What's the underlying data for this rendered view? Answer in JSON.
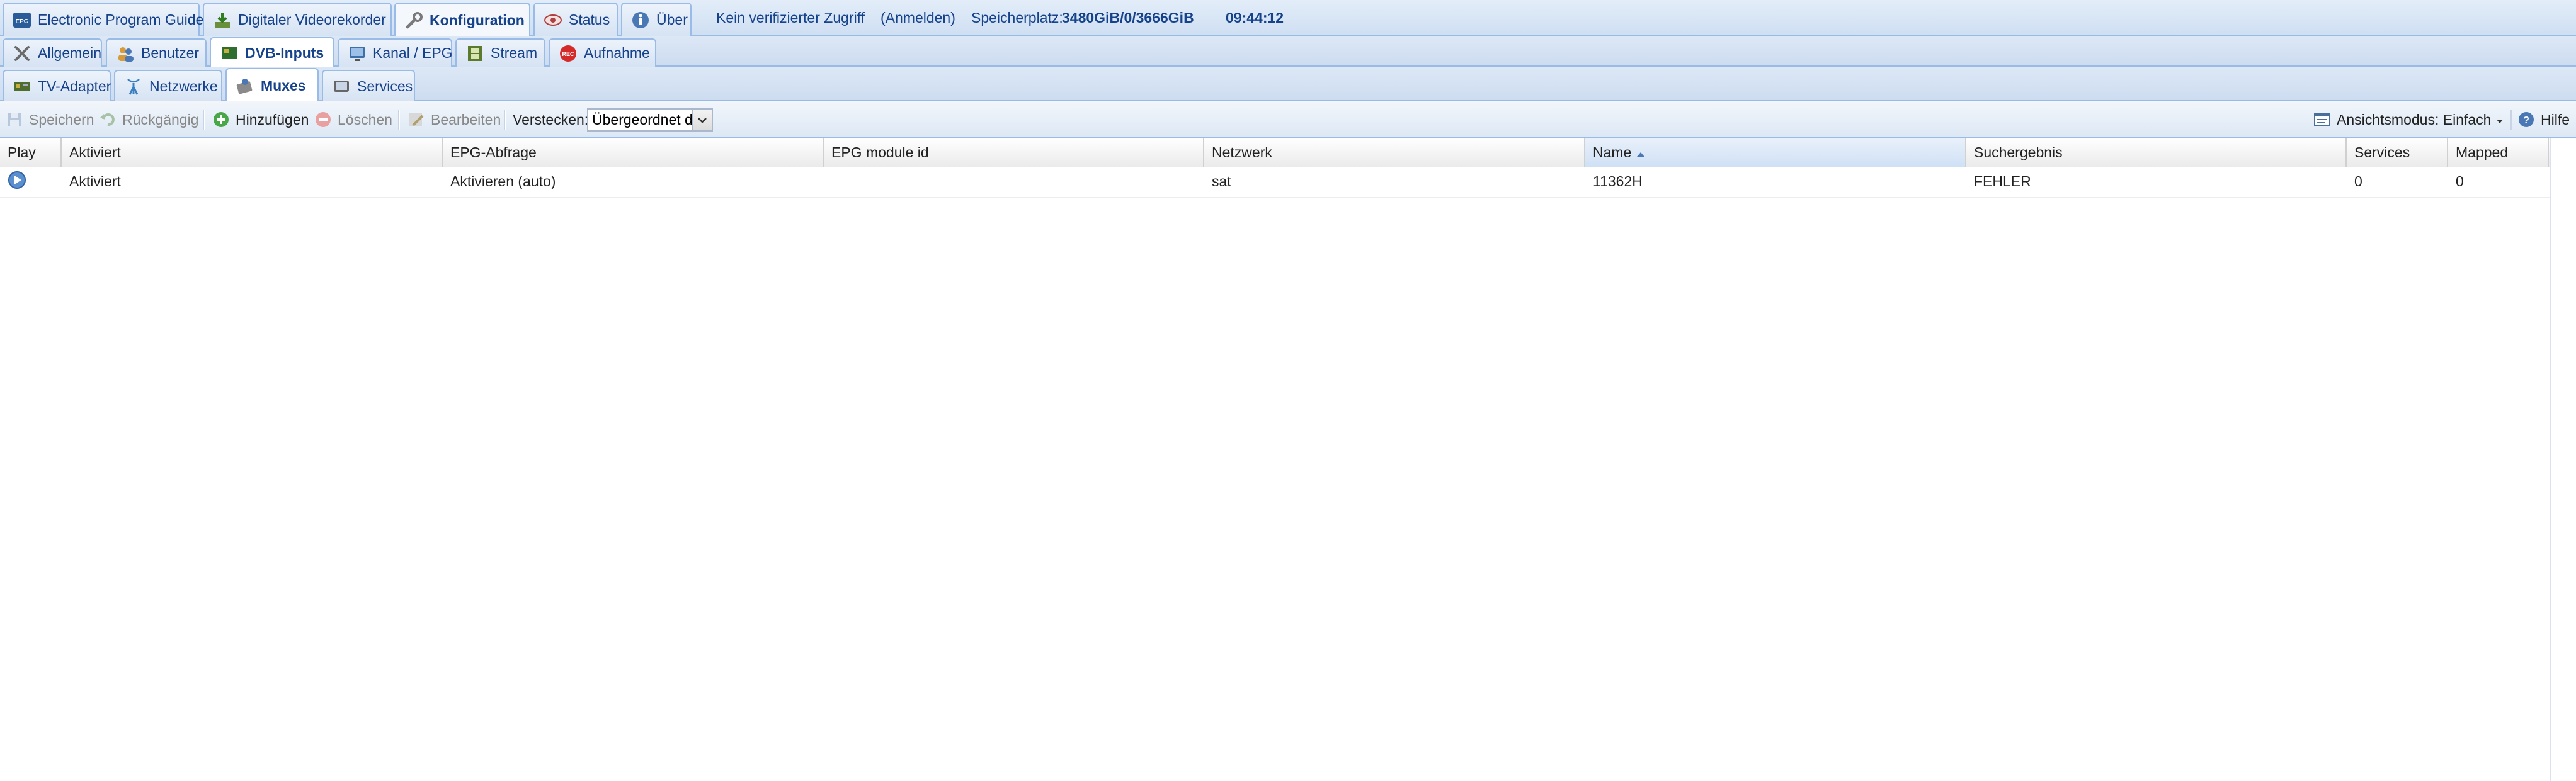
{
  "top_tabs": [
    {
      "label": "Electronic Program Guide",
      "icon": "epg-icon"
    },
    {
      "label": "Digitaler Videorekorder",
      "icon": "download-icon"
    },
    {
      "label": "Konfiguration",
      "icon": "wrench-icon",
      "active": true
    },
    {
      "label": "Status",
      "icon": "eye-icon"
    },
    {
      "label": "Über",
      "icon": "info-icon"
    }
  ],
  "top_info": {
    "access": "Kein verifizierter Zugriff",
    "login": "(Anmelden)",
    "storage_label": "Speicherplatz:",
    "storage_value": "3480GiB/0/3666GiB",
    "time": "09:44:12"
  },
  "config_tabs": [
    {
      "label": "Allgemein",
      "icon": "tools-icon"
    },
    {
      "label": "Benutzer",
      "icon": "users-icon"
    },
    {
      "label": "DVB-Inputs",
      "icon": "tv-card-icon",
      "active": true
    },
    {
      "label": "Kanal / EPG",
      "icon": "monitor-icon"
    },
    {
      "label": "Stream",
      "icon": "film-icon"
    },
    {
      "label": "Aufnahme",
      "icon": "rec-icon"
    }
  ],
  "dvb_tabs": [
    {
      "label": "TV-Adapter",
      "icon": "adapter-icon"
    },
    {
      "label": "Netzwerke",
      "icon": "antenna-icon"
    },
    {
      "label": "Muxes",
      "icon": "mux-icon",
      "active": true
    },
    {
      "label": "Services",
      "icon": "tv-icon"
    }
  ],
  "toolbar": {
    "save": "Speichern",
    "undo": "Rückgängig",
    "add": "Hinzufügen",
    "delete": "Löschen",
    "edit": "Bearbeiten",
    "hide_label": "Verstecken:",
    "hide_value": "Übergeordnet d",
    "view_mode": "Ansichtsmodus: Einfach",
    "help": "Hilfe"
  },
  "grid": {
    "columns": [
      "Play",
      "Aktiviert",
      "EPG-Abfrage",
      "EPG module id",
      "Netzwerk",
      "Name",
      "Suchergebnis",
      "Services",
      "Mapped"
    ],
    "sorted_column": "Name",
    "rows": [
      {
        "play": "play-icon",
        "aktiviert": "Aktiviert",
        "epg_abfrage": "Aktivieren (auto)",
        "epg_module_id": "",
        "netzwerk": "sat",
        "name": "11362H",
        "suchergebnis": "FEHLER",
        "services": "0",
        "mapped": "0"
      }
    ]
  },
  "colors": {
    "header_text": "#15428b",
    "border": "#99bbe8",
    "tab_bg": "#d6e3f3"
  }
}
